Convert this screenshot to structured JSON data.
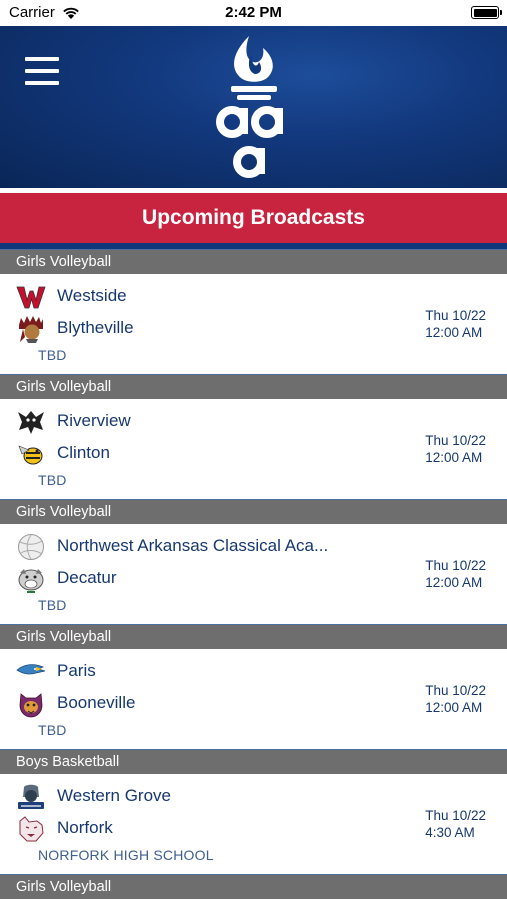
{
  "status_bar": {
    "carrier": "Carrier",
    "time": "2:42 PM"
  },
  "header": {
    "menu_icon": "hamburger-menu-icon",
    "logo_icon": "aaa-torch-logo",
    "title": "Upcoming Broadcasts"
  },
  "colors": {
    "header_blue": "#12387d",
    "banner_red": "#c8233f",
    "section_gray": "#6e6e6e",
    "team_text": "#17386e"
  },
  "broadcasts": [
    {
      "sport": "Girls Volleyball",
      "team1": "Westside",
      "team1_logo": "westside-w-logo",
      "team2": "Blytheville",
      "team2_logo": "blytheville-chief-logo",
      "venue": "TBD",
      "date": "Thu 10/22",
      "time": "12:00 AM"
    },
    {
      "sport": "Girls Volleyball",
      "team1": "Riverview",
      "team1_logo": "riverview-raider-logo",
      "team2": "Clinton",
      "team2_logo": "clinton-yellowjacket-logo",
      "venue": "TBD",
      "date": "Thu 10/22",
      "time": "12:00 AM"
    },
    {
      "sport": "Girls Volleyball",
      "team1": "Northwest Arkansas Classical Aca...",
      "team1_logo": "volleyball-logo",
      "team2": "Decatur",
      "team2_logo": "decatur-bulldog-logo",
      "venue": "TBD",
      "date": "Thu 10/22",
      "time": "12:00 AM"
    },
    {
      "sport": "Girls Volleyball",
      "team1": "Paris",
      "team1_logo": "paris-eagle-logo",
      "team2": "Booneville",
      "team2_logo": "booneville-bearcat-logo",
      "venue": "TBD",
      "date": "Thu 10/22",
      "time": "12:00 AM"
    },
    {
      "sport": "Boys Basketball",
      "team1": "Western Grove",
      "team1_logo": "western-grove-warriors-logo",
      "team2": "Norfork",
      "team2_logo": "norfork-panther-logo",
      "venue": "NORFORK HIGH SCHOOL",
      "date": "Thu 10/22",
      "time": "4:30 AM"
    }
  ],
  "next_section": {
    "sport": "Girls Volleyball"
  }
}
